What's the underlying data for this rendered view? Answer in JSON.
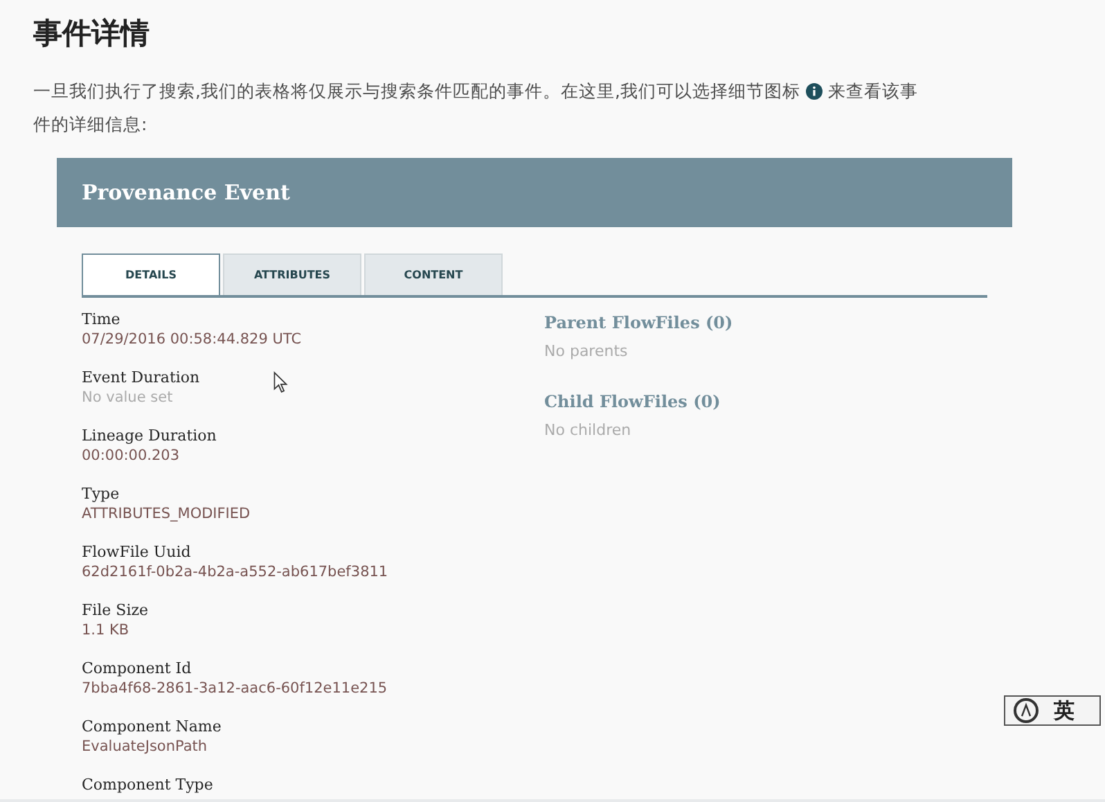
{
  "heading": "事件详情",
  "intro": {
    "before": "一旦我们执行了搜索,我们的表格将仅展示与搜索条件匹配的事件。在这里,我们可以选择细节图标",
    "after": "来查看该事",
    "continuation": "件的详细信息:"
  },
  "dialog": {
    "title": "Provenance Event",
    "tabs": [
      {
        "label": "DETAILS",
        "selected": true
      },
      {
        "label": "ATTRIBUTES",
        "selected": false
      },
      {
        "label": "CONTENT",
        "selected": false
      }
    ],
    "fields": [
      {
        "label": "Time",
        "value": "07/29/2016 00:58:44.829 UTC",
        "kind": "value"
      },
      {
        "label": "Event Duration",
        "value": "No value set",
        "kind": "empty"
      },
      {
        "label": "Lineage Duration",
        "value": "00:00:00.203",
        "kind": "value"
      },
      {
        "label": "Type",
        "value": "ATTRIBUTES_MODIFIED",
        "kind": "value"
      },
      {
        "label": "FlowFile Uuid",
        "value": "62d2161f-0b2a-4b2a-a552-ab617bef3811",
        "kind": "value"
      },
      {
        "label": "File Size",
        "value": "1.1 KB",
        "kind": "value"
      },
      {
        "label": "Component Id",
        "value": "7bba4f68-2861-3a12-aac6-60f12e11e215",
        "kind": "value"
      },
      {
        "label": "Component Name",
        "value": "EvaluateJsonPath",
        "kind": "value"
      },
      {
        "label": "Component Type"
      }
    ],
    "lineage": [
      {
        "title": "Parent FlowFiles (0)",
        "empty_text": "No parents"
      },
      {
        "title": "Child FlowFiles (0)",
        "empty_text": "No children"
      }
    ]
  },
  "ime_indicator": {
    "label": "英"
  }
}
